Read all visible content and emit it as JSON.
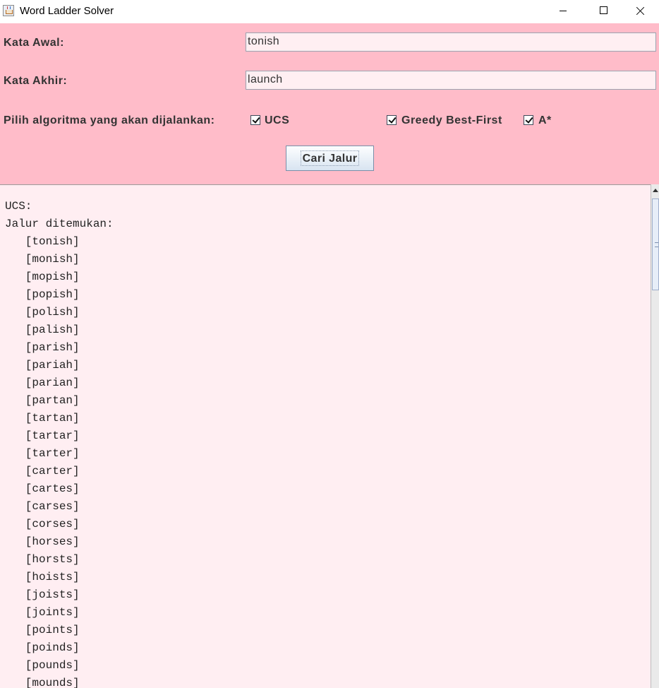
{
  "window": {
    "title": "Word Ladder Solver"
  },
  "form": {
    "start_label": "Kata Awal:",
    "start_value": "tonish",
    "end_label": "Kata Akhir:",
    "end_value": "launch",
    "algo_label": "Pilih algoritma yang akan dijalankan:",
    "algorithms": [
      {
        "label": "UCS",
        "checked": true
      },
      {
        "label": "Greedy Best-First",
        "checked": true
      },
      {
        "label": "A*",
        "checked": true
      }
    ],
    "search_button": "Cari Jalur"
  },
  "output": {
    "lines": [
      "UCS:",
      "Jalur ditemukan:",
      "   [tonish]",
      "   [monish]",
      "   [mopish]",
      "   [popish]",
      "   [polish]",
      "   [palish]",
      "   [parish]",
      "   [pariah]",
      "   [parian]",
      "   [partan]",
      "   [tartan]",
      "   [tartar]",
      "   [tarter]",
      "   [carter]",
      "   [cartes]",
      "   [carses]",
      "   [corses]",
      "   [horses]",
      "   [horsts]",
      "   [hoists]",
      "   [joists]",
      "   [joints]",
      "   [points]",
      "   [poinds]",
      "   [pounds]",
      "   [mounds]"
    ]
  },
  "colors": {
    "panel_bg": "#ffbcc9",
    "field_bg": "#ffeff2",
    "output_bg": "#ffeef2"
  }
}
